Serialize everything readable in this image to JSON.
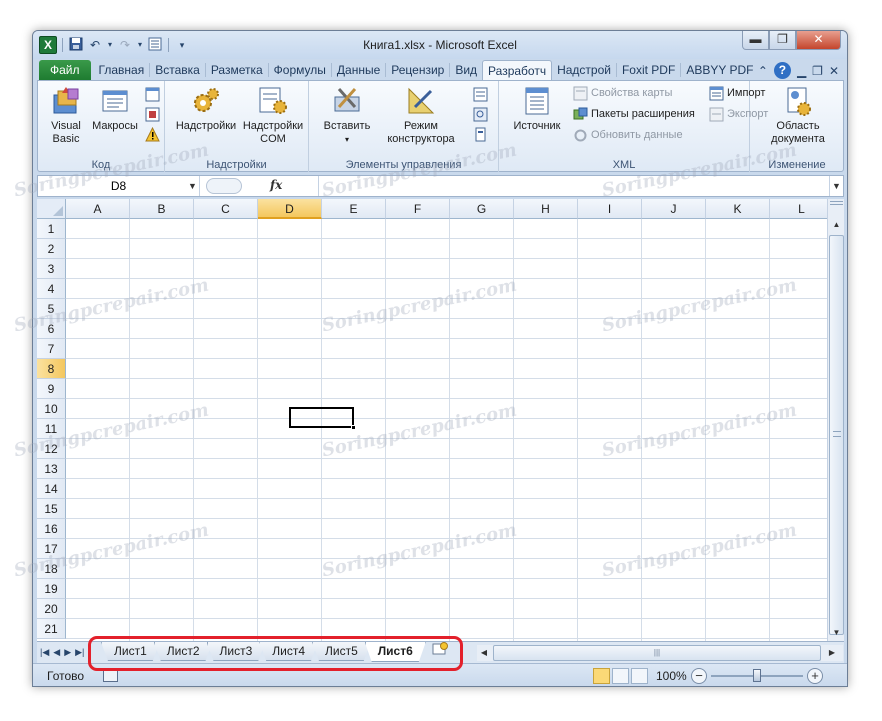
{
  "window": {
    "title": "Книга1.xlsx  -  Microsoft Excel"
  },
  "ribbon_tabs": [
    "Файл",
    "Главная",
    "Вставка",
    "Разметка",
    "Формулы",
    "Данные",
    "Рецензир",
    "Вид",
    "Разработч",
    "Надстрой",
    "Foxit PDF",
    "ABBYY PDF"
  ],
  "active_tab": "Разработч",
  "ribbon": {
    "code": {
      "label": "Код",
      "visual_basic": "Visual\nBasic",
      "macros": "Макросы"
    },
    "addins": {
      "label": "Надстройки",
      "addins_btn": "Надстройки",
      "com_btn": "Надстройки\nCOM"
    },
    "controls": {
      "label": "Элементы управления",
      "insert": "Вставить",
      "design_mode": "Режим\nконструктора"
    },
    "xml": {
      "label": "XML",
      "source": "Источник",
      "map_props": "Свойства карты",
      "expansion_packs": "Пакеты расширения",
      "refresh": "Обновить данные",
      "import": "Импорт",
      "export": "Экспорт"
    },
    "modify": {
      "label": "Изменение",
      "doc_panel": "Область\nдокумента"
    }
  },
  "formula_bar": {
    "name_box": "D8",
    "fx": "fx",
    "value": ""
  },
  "grid": {
    "columns": [
      "A",
      "B",
      "C",
      "D",
      "E",
      "F",
      "G",
      "H",
      "I",
      "J",
      "K",
      "L"
    ],
    "rows": [
      "1",
      "2",
      "3",
      "4",
      "5",
      "6",
      "7",
      "8",
      "9",
      "10",
      "11",
      "12",
      "13",
      "14",
      "15",
      "16",
      "17",
      "18",
      "19",
      "20",
      "21"
    ],
    "selected_column": "D",
    "selected_row": "8"
  },
  "sheets": {
    "tabs": [
      "Лист1",
      "Лист2",
      "Лист3",
      "Лист4",
      "Лист5",
      "Лист6"
    ],
    "active": "Лист6"
  },
  "statusbar": {
    "status": "Готово",
    "zoom": "100%"
  },
  "watermark": "Soringpcrepair.com",
  "colors": {
    "file_tab": "#1d7a2f",
    "highlight": "#e3202b",
    "selected_header": "#f4c75e"
  }
}
